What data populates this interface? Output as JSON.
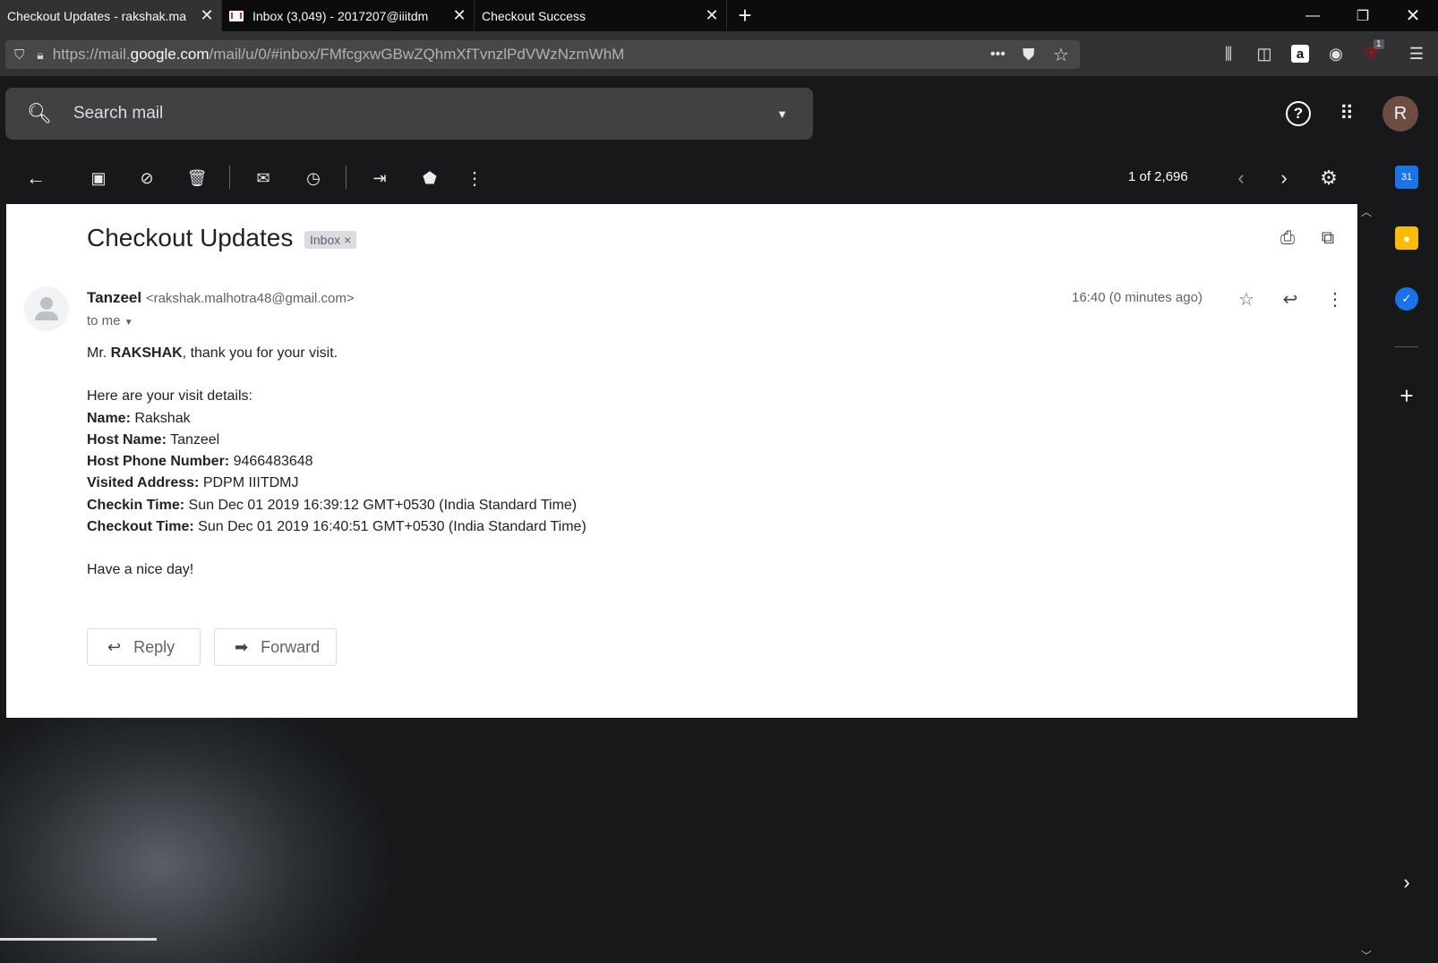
{
  "browser": {
    "tabs": [
      {
        "title": "Checkout Updates - rakshak.ma",
        "active": true
      },
      {
        "title": "Inbox (3,049) - 2017207@iiitdm",
        "active": false
      },
      {
        "title": "Checkout Success",
        "active": false
      }
    ],
    "new_tab": "+",
    "url_prefix": "https://mail.",
    "url_domain": "google.com",
    "url_path": "/mail/u/0/#inbox/FMfcgxwGBwZQhmXfTvnzlPdVWzNzmWhM",
    "page_actions": "•••",
    "ublock_badge": "1"
  },
  "gmail": {
    "search_placeholder": "Search mail",
    "account_initial": "R",
    "pager": "1 of 2,696"
  },
  "message": {
    "subject": "Checkout Updates",
    "label": "Inbox",
    "label_remove": "×",
    "sender_name": "Tanzeel",
    "sender_email": "<rakshak.malhotra48@gmail.com>",
    "to_line": "to me",
    "time": "16:40 (0 minutes ago)",
    "greeting_prefix": "Mr. ",
    "greeting_name": "RAKSHAK",
    "greeting_suffix": ", thank you for your visit.",
    "details_intro": "Here are your visit details:",
    "details": [
      {
        "key": "Name:",
        "value": " Rakshak"
      },
      {
        "key": "Host Name:",
        "value": " Tanzeel"
      },
      {
        "key": "Host Phone Number:",
        "value": " 9466483648"
      },
      {
        "key": "Visited Address:",
        "value": " PDPM IIITDMJ"
      },
      {
        "key": "Checkin Time:",
        "value": " Sun Dec 01 2019 16:39:12 GMT+0530 (India Standard Time)"
      },
      {
        "key": "Checkout Time:",
        "value": " Sun Dec 01 2019 16:40:51 GMT+0530 (India Standard Time)"
      }
    ],
    "closing": "Have a nice day!",
    "reply_label": "Reply",
    "forward_label": "Forward"
  },
  "side_panel": {
    "calendar_day": "31"
  }
}
